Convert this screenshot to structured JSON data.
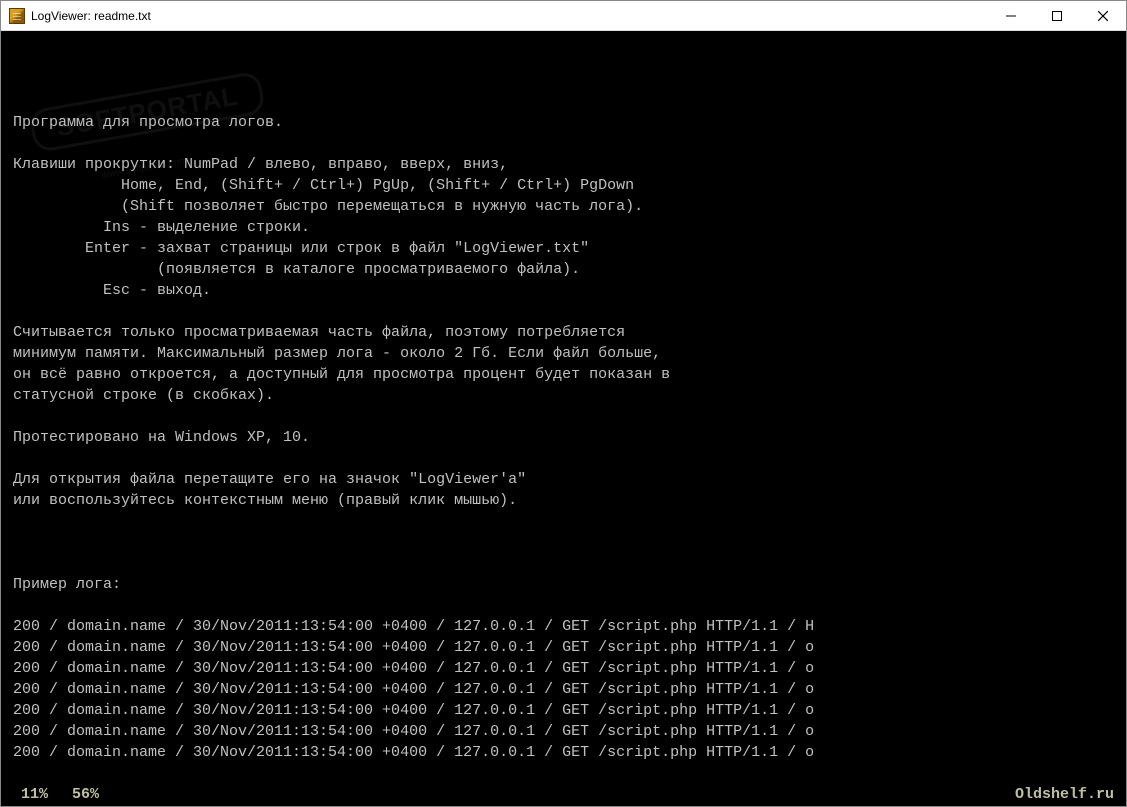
{
  "window": {
    "title": "LogViewer: readme.txt"
  },
  "content": {
    "lines": [
      "Программа для просмотра логов.",
      "",
      "Клавиши прокрутки: NumPad / влево, вправо, вверх, вниз,",
      "            Home, End, (Shift+ / Ctrl+) PgUp, (Shift+ / Ctrl+) PgDown",
      "            (Shift позволяет быстро перемещаться в нужную часть лога).",
      "          Ins - выделение строки.",
      "        Enter - захват страницы или строк в файл \"LogViewer.txt\"",
      "                (появляется в каталоге просматриваемого файла).",
      "          Esc - выход.",
      "",
      "Считывается только просматриваемая часть файла, поэтому потребляется",
      "минимум памяти. Максимальный размер лога - около 2 Гб. Если файл больше,",
      "он всё равно откроется, а доступный для просмотра процент будет показан в",
      "статусной строке (в скобках).",
      "",
      "Протестировано на Windows XP, 10.",
      "",
      "Для открытия файла перетащите его на значок \"LogViewer'а\"",
      "или воспользуйтесь контекстным меню (правый клик мышью).",
      "",
      "",
      "",
      "Пример лога:",
      "",
      "200 / domain.name / 30/Nov/2011:13:54:00 +0400 / 127.0.0.1 / GET /script.php HTTP/1.1 / H",
      "200 / domain.name / 30/Nov/2011:13:54:00 +0400 / 127.0.0.1 / GET /script.php HTTP/1.1 / o",
      "200 / domain.name / 30/Nov/2011:13:54:00 +0400 / 127.0.0.1 / GET /script.php HTTP/1.1 / o",
      "200 / domain.name / 30/Nov/2011:13:54:00 +0400 / 127.0.0.1 / GET /script.php HTTP/1.1 / o",
      "200 / domain.name / 30/Nov/2011:13:54:00 +0400 / 127.0.0.1 / GET /script.php HTTP/1.1 / o",
      "200 / domain.name / 30/Nov/2011:13:54:00 +0400 / 127.0.0.1 / GET /script.php HTTP/1.1 / o",
      "200 / domain.name / 30/Nov/2011:13:54:00 +0400 / 127.0.0.1 / GET /script.php HTTP/1.1 / o"
    ]
  },
  "statusbar": {
    "percent1": "11%",
    "percent2": "56%",
    "right": "Oldshelf.ru"
  },
  "watermark": {
    "main": "SOFTPORTAL",
    "sub": "www.softportal.com"
  }
}
